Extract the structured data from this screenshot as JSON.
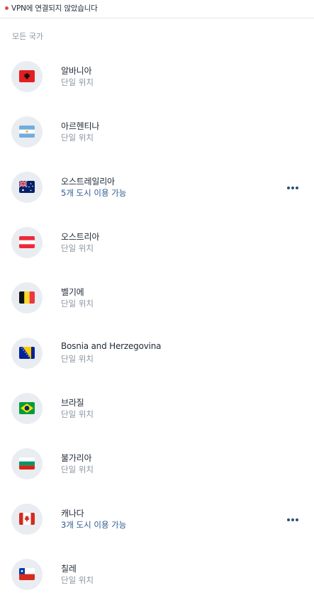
{
  "status": {
    "text": "VPN에 연결되지 않았습니다",
    "dot_color": "#e5484d"
  },
  "section_title": "모든 국가",
  "countries": [
    {
      "name": "알바니아",
      "subtitle": "단일 위치",
      "flag": "albania-flag",
      "multi": false
    },
    {
      "name": "아르헨티나",
      "subtitle": "단일 위치",
      "flag": "argentina-flag",
      "multi": false
    },
    {
      "name": "오스트레일리아",
      "subtitle": "5개 도시 이용 가능",
      "flag": "australia-flag",
      "multi": true
    },
    {
      "name": "오스트리아",
      "subtitle": "단일 위치",
      "flag": "austria-flag",
      "multi": false
    },
    {
      "name": "벨기에",
      "subtitle": "단일 위치",
      "flag": "belgium-flag",
      "multi": false
    },
    {
      "name": "Bosnia and Herzegovina",
      "subtitle": "단일 위치",
      "flag": "bosnia-flag",
      "multi": false
    },
    {
      "name": "브라질",
      "subtitle": "단일 위치",
      "flag": "brazil-flag",
      "multi": false
    },
    {
      "name": "불가리아",
      "subtitle": "단일 위치",
      "flag": "bulgaria-flag",
      "multi": false
    },
    {
      "name": "캐나다",
      "subtitle": "3개 도시 이용 가능",
      "flag": "canada-flag",
      "multi": true
    },
    {
      "name": "칠레",
      "subtitle": "단일 위치",
      "flag": "chile-flag",
      "multi": false
    }
  ],
  "colors": {
    "accent": "#2b5a8f",
    "secondary_text": "#8a94a3",
    "flag_circle": "#e9edf2"
  }
}
